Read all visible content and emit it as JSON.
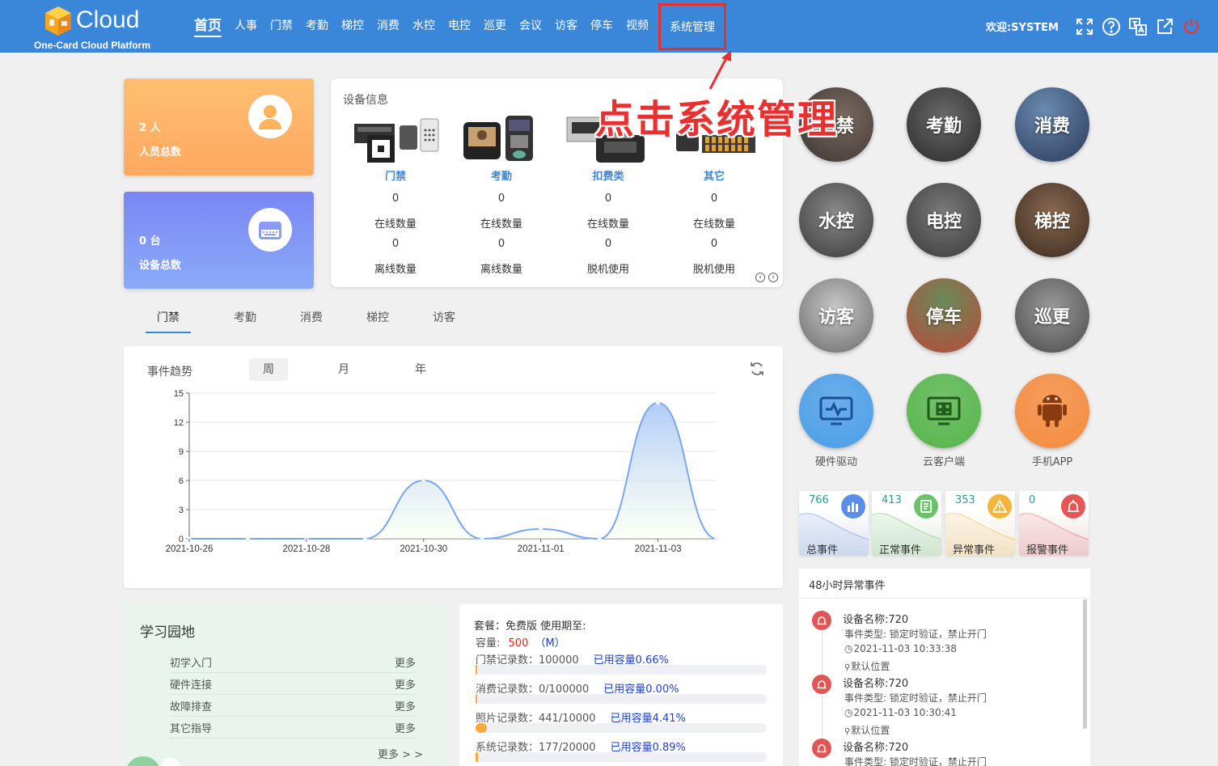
{
  "header": {
    "logo_text": "Cloud",
    "logo_sub": "One-Card Cloud Platform",
    "nav": [
      "首页",
      "人事",
      "门禁",
      "考勤",
      "梯控",
      "消费",
      "水控",
      "电控",
      "巡更",
      "会议",
      "访客",
      "停车",
      "视频",
      "系统管理"
    ],
    "welcome": "欢迎:SYSTEM",
    "icons": [
      "fullscreen-icon",
      "help-icon",
      "language-icon",
      "external-link-icon",
      "power-icon"
    ]
  },
  "annotation": {
    "text": "点击系统管理"
  },
  "stats": {
    "people_num": "2 人",
    "people_label": "人员总数",
    "device_num": "0 台",
    "device_label": "设备总数"
  },
  "devices": {
    "title": "设备信息",
    "cols": [
      {
        "name": "门禁",
        "v1": "0",
        "l1": "在线数量",
        "v2": "0",
        "l2": "离线数量"
      },
      {
        "name": "考勤",
        "v1": "0",
        "l1": "在线数量",
        "v2": "0",
        "l2": "离线数量"
      },
      {
        "name": "扣费类",
        "v1": "0",
        "l1": "在线数量",
        "v2": "0",
        "l2": "脱机使用"
      },
      {
        "name": "其它",
        "v1": "0",
        "l1": "在线数量",
        "v2": "0",
        "l2": "脱机使用"
      }
    ]
  },
  "tabs": [
    "门禁",
    "考勤",
    "消费",
    "梯控",
    "访客"
  ],
  "chart": {
    "title": "事件趋势",
    "periods": [
      "周",
      "月",
      "年"
    ]
  },
  "chart_data": {
    "type": "area",
    "categories": [
      "2021-10-26",
      "2021-10-27",
      "2021-10-28",
      "2021-10-29",
      "2021-10-30",
      "2021-10-31",
      "2021-11-01",
      "2021-11-02",
      "2021-11-03",
      "2021-11-04"
    ],
    "x_tick_labels": [
      "2021-10-26",
      "2021-10-28",
      "2021-10-30",
      "2021-11-01",
      "2021-11-03"
    ],
    "values": [
      0,
      0,
      0,
      0,
      6,
      0,
      1,
      0,
      14,
      0
    ],
    "yticks": [
      0,
      3,
      6,
      9,
      12,
      15
    ],
    "ylim": [
      0,
      15
    ],
    "grid": true,
    "colors": {
      "line": "#7aa7f0",
      "fill_top": "#a8c6f8"
    }
  },
  "study": {
    "title": "学习园地",
    "rows": [
      {
        "label": "初学入门",
        "more": "更多"
      },
      {
        "label": "硬件连接",
        "more": "更多"
      },
      {
        "label": "故障排查",
        "more": "更多"
      },
      {
        "label": "其它指导",
        "more": "更多"
      }
    ],
    "more": "更多 > >"
  },
  "package": {
    "plan": "套餐：免费版 使用期至:",
    "capacity_label": "容量:",
    "capacity_value": "500",
    "capacity_unit": "（M）",
    "records": [
      {
        "label": "门禁记录数：100000",
        "used": "已用容量0.66%",
        "fill": 0.0066
      },
      {
        "label": "消费记录数：0/100000",
        "used": "已用容量0.00%",
        "fill": 0
      },
      {
        "label": "照片记录数：441/10000",
        "used": "已用容量4.41%",
        "fill": 0.0441
      },
      {
        "label": "系统记录数：177/20000",
        "used": "已用容量0.89%",
        "fill": 0.0089
      }
    ]
  },
  "modules": [
    "门禁",
    "考勤",
    "消费",
    "水控",
    "电控",
    "梯控",
    "访客",
    "停车",
    "巡更"
  ],
  "apps": [
    {
      "label": "硬件驱动",
      "color": "#4a9ee8"
    },
    {
      "label": "云客户端",
      "color": "#55b54a"
    },
    {
      "label": "手机APP",
      "color": "#f58a3c"
    }
  ],
  "events": [
    {
      "num": "766",
      "label": "总事件",
      "color": "#5a8de8"
    },
    {
      "num": "413",
      "label": "正常事件",
      "color": "#6cc26a"
    },
    {
      "num": "353",
      "label": "异常事件",
      "color": "#f5b53c"
    },
    {
      "num": "0",
      "label": "报警事件",
      "color": "#e85555"
    }
  ],
  "alerts": {
    "title": "48小时异常事件",
    "items": [
      {
        "name": "设备名称:720",
        "type": "事件类型: 锁定时验证，禁止开门",
        "time": "2021-11-03 10:33:38",
        "pos": "默认位置"
      },
      {
        "name": "设备名称:720",
        "type": "事件类型: 锁定时验证，禁止开门",
        "time": "2021-11-03 10:30:41",
        "pos": "默认位置"
      },
      {
        "name": "设备名称:720",
        "type": "事件类型: 锁定时验证，禁止开门",
        "time": "",
        "pos": ""
      }
    ]
  }
}
